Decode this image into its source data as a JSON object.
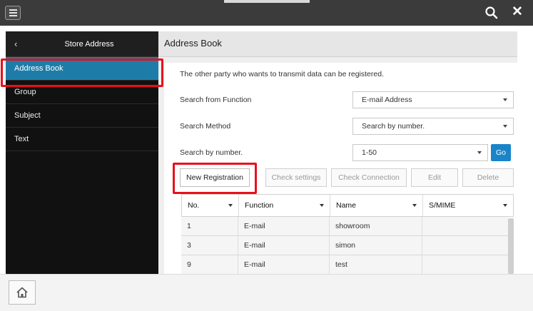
{
  "sidebar": {
    "title": "Store Address",
    "back_icon": "chevron-left-icon",
    "items": [
      {
        "label": "Address Book",
        "active": true
      },
      {
        "label": "Group",
        "active": false
      },
      {
        "label": "Subject",
        "active": false
      },
      {
        "label": "Text",
        "active": false
      }
    ]
  },
  "main": {
    "title": "Address Book",
    "description": "The other party who wants to transmit data can be registered.",
    "search_from_function": {
      "label": "Search from Function",
      "value": "E-mail Address"
    },
    "search_method": {
      "label": "Search Method",
      "value": "Search by number."
    },
    "search_by_number": {
      "label": "Search by number.",
      "value": "1-50",
      "go_label": "Go"
    },
    "buttons": {
      "new_registration": "New Registration",
      "check_settings": "Check settings",
      "check_connection": "Check Connection",
      "edit": "Edit",
      "delete": "Delete"
    },
    "table": {
      "headers": [
        "No.",
        "Function",
        "Name",
        "S/MIME"
      ],
      "rows": [
        [
          "1",
          "E-mail",
          "showroom",
          ""
        ],
        [
          "3",
          "E-mail",
          "simon",
          ""
        ],
        [
          "9",
          "E-mail",
          "test",
          ""
        ]
      ]
    }
  },
  "icons": {
    "menu": "hamburger-icon",
    "search": "search-icon",
    "close": "close-icon",
    "home": "home-icon"
  },
  "colors": {
    "accent": "#1e7da8",
    "highlight": "#e8101c",
    "go_button": "#1a84c8"
  }
}
